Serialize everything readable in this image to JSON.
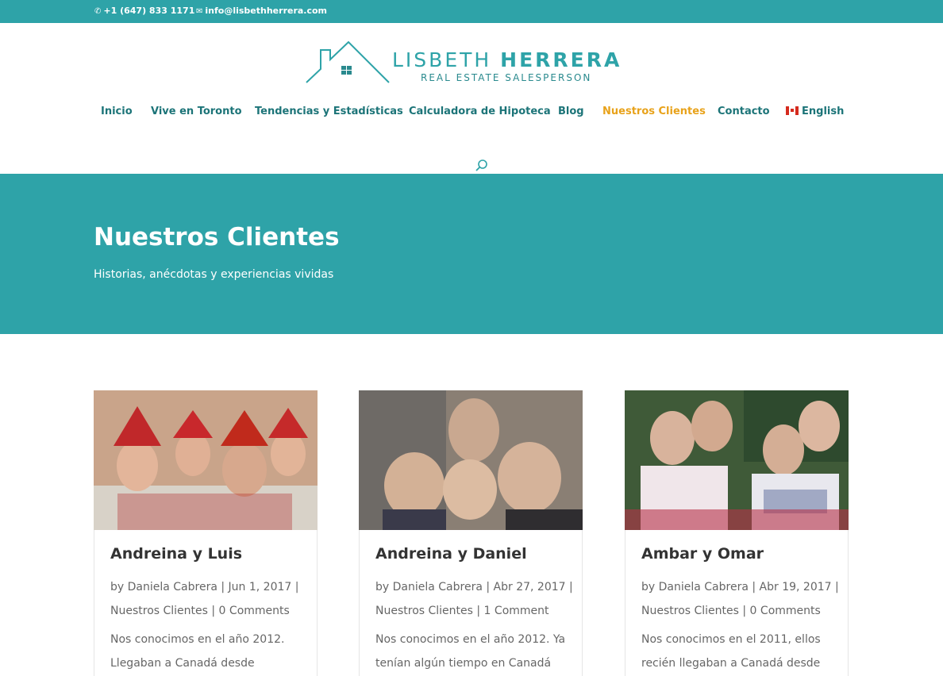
{
  "topbar": {
    "phone": "+1 (647) 833 1171",
    "email": "info@lisbethherrera.com"
  },
  "logo": {
    "first_name": "LISBETH",
    "last_name": "HERRERA",
    "subtitle": "REAL ESTATE SALESPERSON"
  },
  "nav": {
    "items": [
      {
        "label": "Inicio"
      },
      {
        "label": "Vive en Toronto"
      },
      {
        "label": "Tendencias y Estadísticas"
      },
      {
        "label": "Calculadora de Hipoteca"
      },
      {
        "label": "Blog"
      },
      {
        "label": "Nuestros Clientes",
        "active": true
      },
      {
        "label": "Contacto"
      },
      {
        "label": "English"
      }
    ]
  },
  "hero": {
    "title": "Nuestros Clientes",
    "subtitle": "Historias, anécdotas y experiencias vividas"
  },
  "posts": [
    {
      "title": "Andreina y Luis",
      "meta_line1": "by Daniela Cabrera | Jun 1, 2017 |",
      "meta_line2": "Nuestros Clientes | 0 Comments",
      "excerpt_line1": "Nos conocimos en el año 2012.",
      "excerpt_line2": "Llegaban a Canadá desde"
    },
    {
      "title": "Andreina y Daniel",
      "meta_line1": "by Daniela Cabrera | Abr 27, 2017 |",
      "meta_line2": "Nuestros Clientes | 1 Comment",
      "excerpt_line1": "Nos conocimos en el año 2012. Ya",
      "excerpt_line2": "tenían algún tiempo en Canadá"
    },
    {
      "title": "Ambar y Omar",
      "meta_line1": "by Daniela Cabrera | Abr 19, 2017 |",
      "meta_line2": "Nuestros Clientes | 0 Comments",
      "excerpt_line1": "Nos conocimos en el 2011, ellos",
      "excerpt_line2": "recién llegaban a Canadá desde"
    }
  ],
  "colors": {
    "brand_teal": "#2ea3a8",
    "nav_text": "#1c7478",
    "nav_active": "#e8a21a"
  }
}
